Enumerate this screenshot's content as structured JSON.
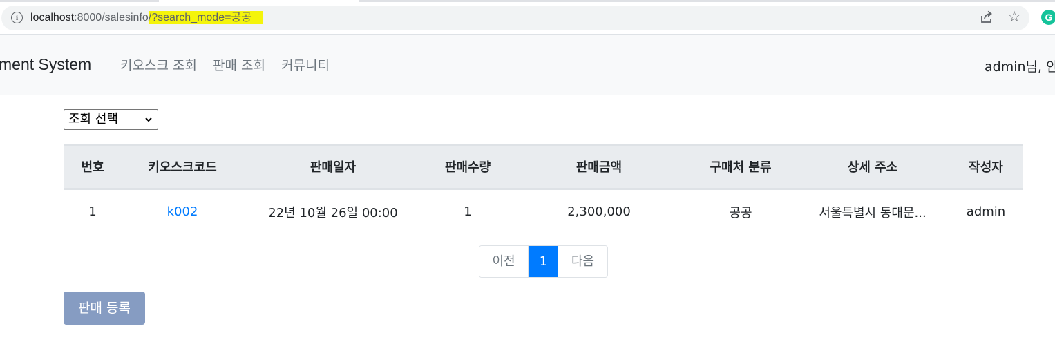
{
  "browser": {
    "url_host": "localhost",
    "url_port_path": ":8000/salesinfo",
    "url_query": "/?search_mode=공공",
    "icons": [
      "info-icon",
      "share-icon",
      "star-icon",
      "grammarly-icon"
    ],
    "info_glyph": "i",
    "star_glyph": "☆",
    "grammarly_glyph": "G",
    "highlight_color": "#f4f40b"
  },
  "navbar": {
    "brand": "ment System",
    "links": [
      "키오스크 조회",
      "판매 조회",
      "커뮤니티"
    ],
    "user_greeting": "admin님, 안"
  },
  "search": {
    "selected_option": "조회 선택"
  },
  "table": {
    "headers": [
      "번호",
      "키오스크코드",
      "판매일자",
      "판매수량",
      "판매금액",
      "구매처 분류",
      "상세 주소",
      "작성자"
    ],
    "rows": [
      {
        "no": "1",
        "kiosk_code": "k002",
        "sale_date": "22년 10월 26일 00:00",
        "quantity": "1",
        "amount": "2,300,000",
        "buyer_type": "공공",
        "address": "서울특별시 동대문...",
        "author": "admin"
      }
    ]
  },
  "pagination": {
    "prev": "이전",
    "current": "1",
    "next": "다음"
  },
  "actions": {
    "register": "판매 등록"
  },
  "colors": {
    "accent": "#007bff",
    "register_button": "#869cc2",
    "header_bg": "#e9ecef",
    "navbar_bg": "#f8f9fa"
  }
}
